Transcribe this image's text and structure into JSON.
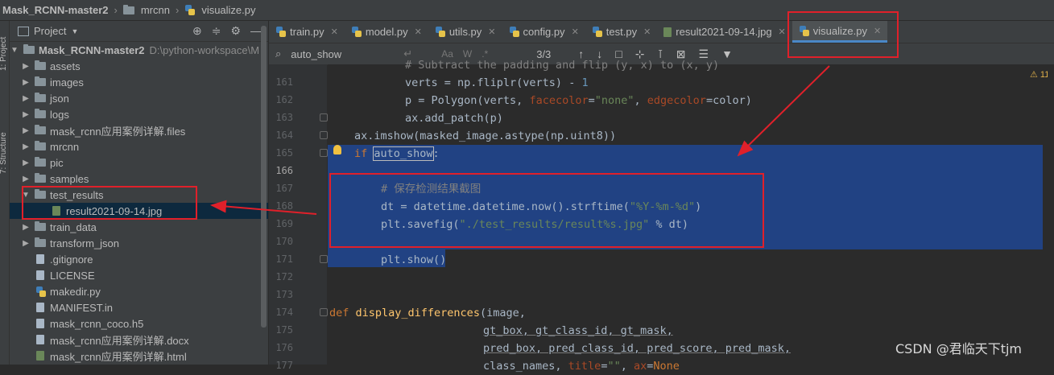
{
  "breadcrumb": {
    "project": "Mask_RCNN-master2",
    "folder": "mrcnn",
    "file": "visualize.py"
  },
  "side_tabs": {
    "project": "1: Project",
    "structure": "7: Structure"
  },
  "project_panel": {
    "title": "Project",
    "root": {
      "name": "Mask_RCNN-master2",
      "path": "D:\\python-workspace\\M"
    },
    "items": [
      {
        "label": "assets",
        "type": "folder"
      },
      {
        "label": "images",
        "type": "folder"
      },
      {
        "label": "json",
        "type": "folder"
      },
      {
        "label": "logs",
        "type": "folder"
      },
      {
        "label": "mask_rcnn应用案例详解.files",
        "type": "folder"
      },
      {
        "label": "mrcnn",
        "type": "folder"
      },
      {
        "label": "pic",
        "type": "folder"
      },
      {
        "label": "samples",
        "type": "folder"
      },
      {
        "label": "test_results",
        "type": "folder-open"
      },
      {
        "label": "result2021-09-14.jpg",
        "type": "file-image"
      },
      {
        "label": "train_data",
        "type": "folder"
      },
      {
        "label": "transform_json",
        "type": "folder"
      },
      {
        "label": ".gitignore",
        "type": "file"
      },
      {
        "label": "LICENSE",
        "type": "file"
      },
      {
        "label": "makedir.py",
        "type": "file"
      },
      {
        "label": "MANIFEST.in",
        "type": "file"
      },
      {
        "label": "mask_rcnn_coco.h5",
        "type": "file"
      },
      {
        "label": "mask_rcnn应用案例详解.docx",
        "type": "file"
      },
      {
        "label": "mask_rcnn应用案例详解.html",
        "type": "file"
      }
    ]
  },
  "tabs": [
    {
      "label": "train.py"
    },
    {
      "label": "model.py"
    },
    {
      "label": "utils.py"
    },
    {
      "label": "config.py"
    },
    {
      "label": "test.py"
    },
    {
      "label": "result2021-09-14.jpg"
    },
    {
      "label": "visualize.py"
    }
  ],
  "search": {
    "value": "auto_show",
    "count": "3/3",
    "opt_case": "Aa",
    "opt_word": "W",
    "opt_regex": ".*"
  },
  "editor": {
    "warnings": "11",
    "line_numbers": [
      "161",
      "162",
      "163",
      "164",
      "165",
      "166",
      "167",
      "168",
      "169",
      "170",
      "171",
      "172",
      "173",
      "174",
      "175",
      "176",
      "177"
    ],
    "lines": {
      "l161": "# Subtract the padding and flip (y, x) to (x, y)",
      "l162a": "verts = np.fliplr(verts) - ",
      "l162b": "1",
      "l163a": "p = Polygon(verts, ",
      "l163b": "facecolor",
      "l163c": "=",
      "l163d": "\"none\"",
      "l163e": ", ",
      "l163f": "edgecolor",
      "l163g": "=color)",
      "l164": "ax.add_patch(p)",
      "l165": "ax.imshow(masked_image.astype(np.uint8))",
      "l166a": "if ",
      "l166b": "auto_show",
      "l166c": ":",
      "l168": "# 保存检测结果截图",
      "l169a": "dt = datetime.datetime.now().strftime(",
      "l169b": "\"%Y-%m-%d\"",
      "l169c": ")",
      "l170a": "plt.savefig(",
      "l170b": "\"./test_results/result%s.jpg\"",
      "l170c": " % dt)",
      "l172": "plt.show()",
      "l175a": "def ",
      "l175b": "display_differences",
      "l175c": "(image,",
      "l176": "gt_box, gt_class_id, gt_mask,",
      "l177": "pred_box, pred_class_id, pred_score, pred_mask,",
      "l178a": "class_names, ",
      "l178b": "title",
      "l178c": "=",
      "l178d": "\"\"",
      "l178e": ", ",
      "l178f": "ax",
      "l178g": "=",
      "l178h": "None"
    }
  },
  "watermark": "CSDN @君临天下tjm",
  "colors": {
    "annotation": "#e0202a",
    "selection": "#214283",
    "keyword": "#cc7832",
    "string": "#6a8759",
    "function": "#ffc66d"
  }
}
